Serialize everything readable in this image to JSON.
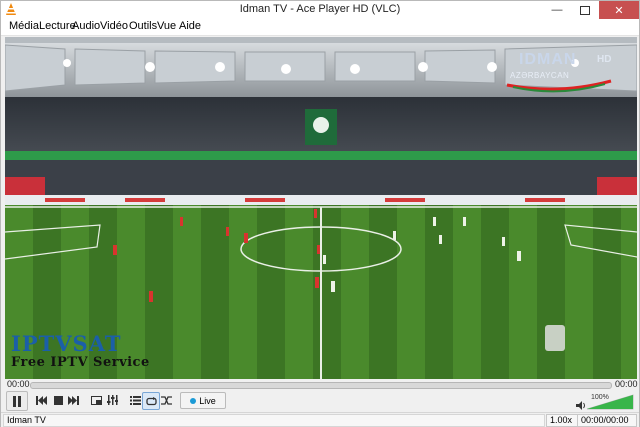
{
  "window": {
    "title": "Idman TV - Ace Player HD (VLC)",
    "minimize_icon": "minimize-icon",
    "maximize_icon": "maximize-icon",
    "close_icon": "close-icon"
  },
  "menu": [
    "Média",
    "Lecture",
    "Audio",
    "Vidéo",
    "Outils",
    "Vue",
    "Aide"
  ],
  "video": {
    "channel_logo": {
      "name": "IDMAN",
      "sub": "AZƏRBAYCAN",
      "badge": "HD"
    },
    "overlay": {
      "title": "IPTVSAT",
      "subtitle": "Free IPTV Service"
    }
  },
  "seek": {
    "elapsed": "00:00",
    "remaining": "00:00",
    "progress": 0
  },
  "controls": {
    "live_label": "Live",
    "volume_percent": "100%",
    "volume_level": 1.0
  },
  "status": {
    "channel": "Idman TV",
    "speed": "1.00x",
    "time": "00:00/00:00"
  },
  "colors": {
    "pitch": "#3f7a22",
    "live_dot": "#1b9ad6",
    "volume_fill": "#39b54a"
  }
}
